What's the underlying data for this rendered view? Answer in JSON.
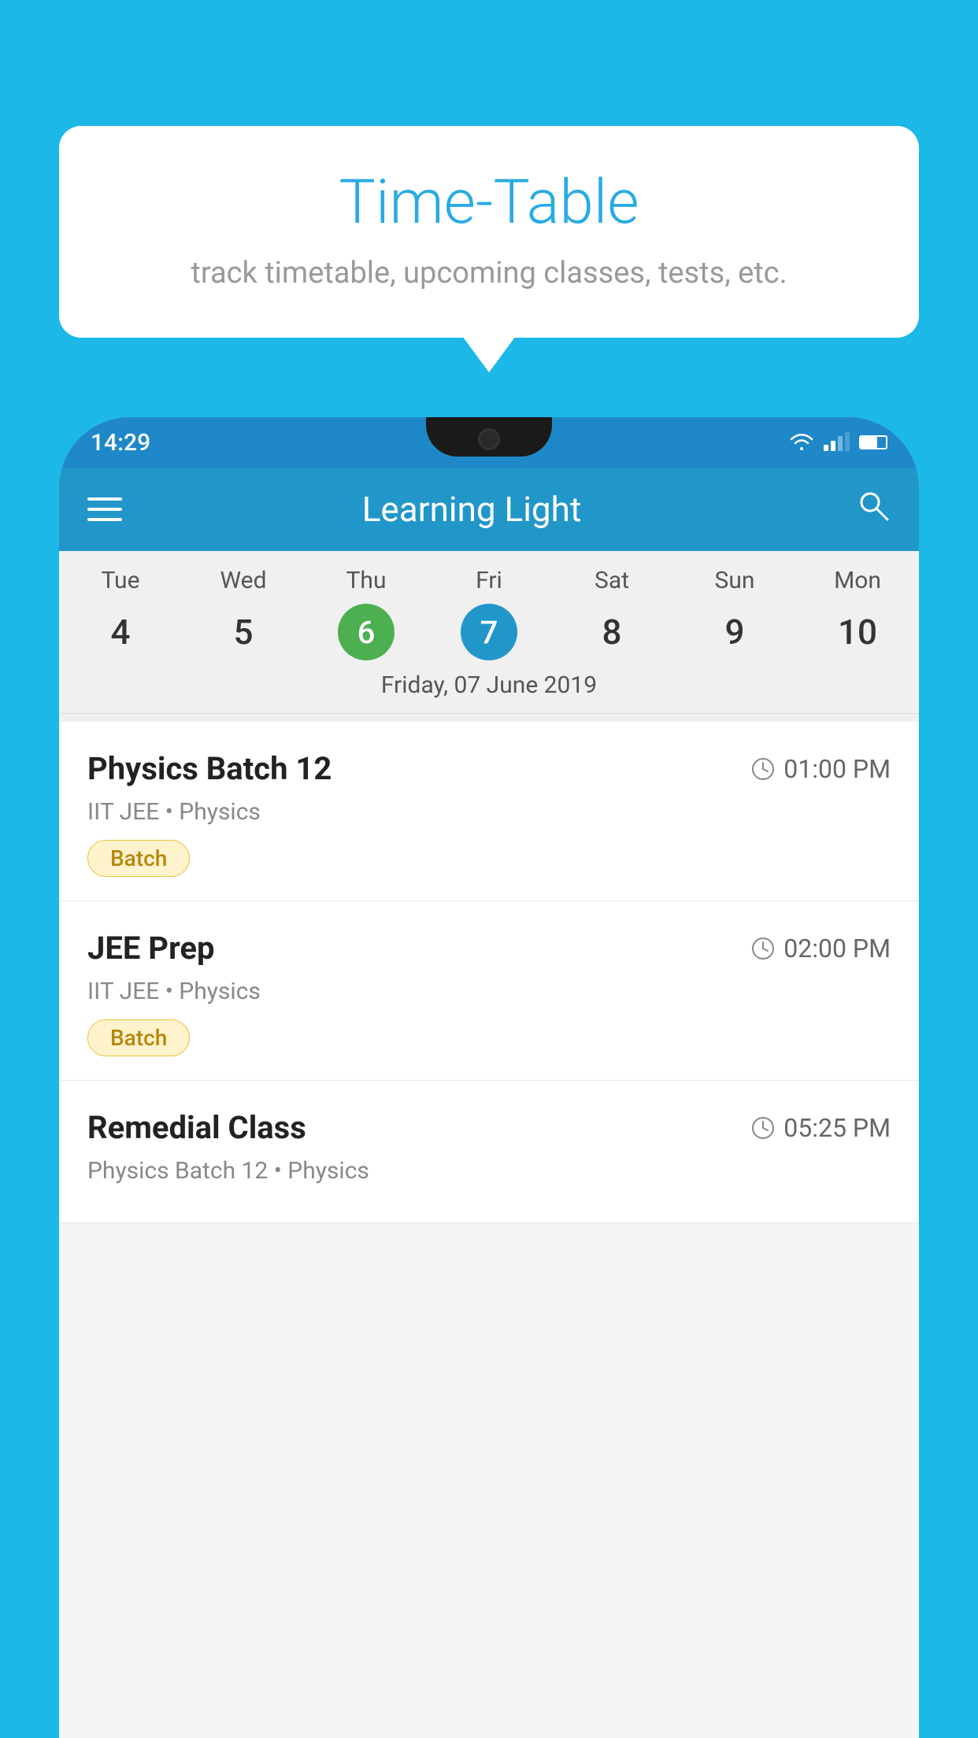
{
  "background_color": "#1BB8E8",
  "tooltip": {
    "title": "Time-Table",
    "subtitle": "track timetable, upcoming classes, tests, etc."
  },
  "phone": {
    "status_bar": {
      "time": "14:29"
    },
    "app_bar": {
      "title": "Learning Light"
    },
    "calendar": {
      "days": [
        {
          "name": "Tue",
          "number": "4",
          "state": "normal"
        },
        {
          "name": "Wed",
          "number": "5",
          "state": "normal"
        },
        {
          "name": "Thu",
          "number": "6",
          "state": "today"
        },
        {
          "name": "Fri",
          "number": "7",
          "state": "selected"
        },
        {
          "name": "Sat",
          "number": "8",
          "state": "normal"
        },
        {
          "name": "Sun",
          "number": "9",
          "state": "normal"
        },
        {
          "name": "Mon",
          "number": "10",
          "state": "normal"
        }
      ],
      "selected_date": "Friday, 07 June 2019"
    },
    "classes": [
      {
        "name": "Physics Batch 12",
        "time": "01:00 PM",
        "subject": "IIT JEE • Physics",
        "badge": "Batch"
      },
      {
        "name": "JEE Prep",
        "time": "02:00 PM",
        "subject": "IIT JEE • Physics",
        "badge": "Batch"
      },
      {
        "name": "Remedial Class",
        "time": "05:25 PM",
        "subject": "Physics Batch 12 • Physics",
        "badge": null
      }
    ]
  }
}
